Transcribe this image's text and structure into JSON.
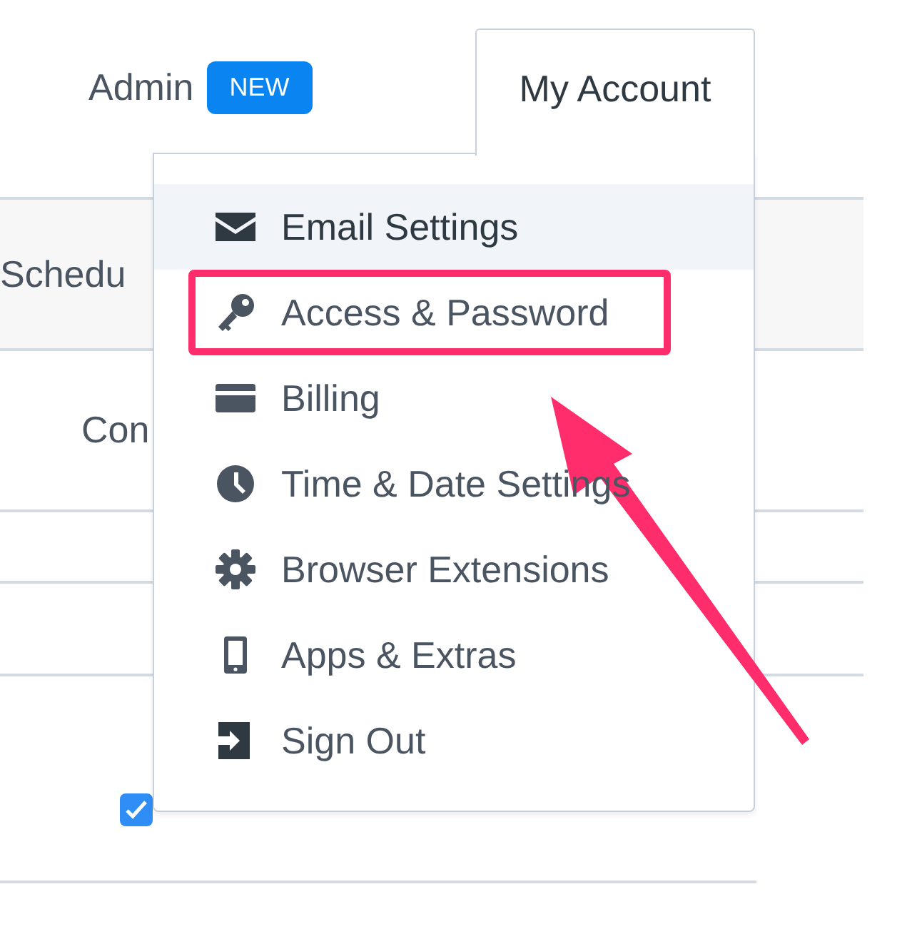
{
  "tabs": [
    {
      "label": "Admin",
      "badge": "NEW",
      "selected": false
    },
    {
      "label": "My Account",
      "selected": true
    }
  ],
  "background": {
    "column_1_header": "Schedu",
    "row_1_cell": "Con",
    "show_empty_slots": {
      "checked": true
    }
  },
  "menu": [
    {
      "label": "Email Settings",
      "hovered": true,
      "highlighted": false
    },
    {
      "label": "Access & Password",
      "hovered": false,
      "highlighted": true
    },
    {
      "label": "Billing",
      "hovered": false,
      "highlighted": false
    },
    {
      "label": "Time & Date Settings",
      "hovered": false,
      "highlighted": false
    },
    {
      "label": "Browser Extensions",
      "hovered": false,
      "highlighted": false
    },
    {
      "label": "Apps & Extras",
      "hovered": false,
      "highlighted": false
    },
    {
      "label": "Sign Out",
      "hovered": false,
      "highlighted": false
    }
  ]
}
